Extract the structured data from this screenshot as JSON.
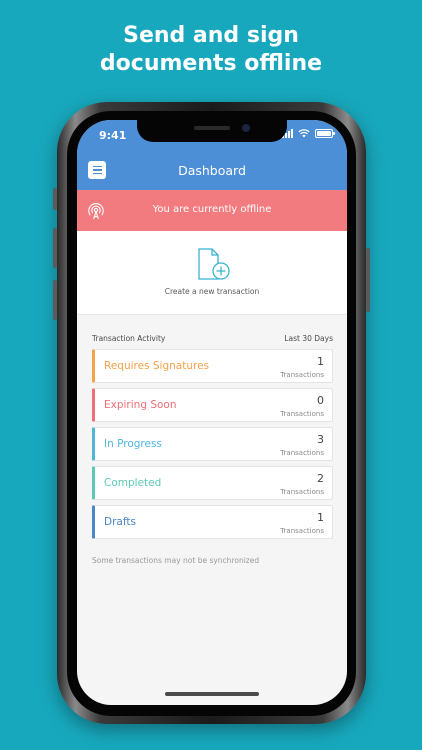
{
  "promo": {
    "headline_line1": "Send and sign",
    "headline_line2": "documents offline"
  },
  "status_bar": {
    "time": "9:41"
  },
  "header": {
    "title": "Dashboard",
    "menu_icon": "hamburger-menu-icon"
  },
  "offline_banner": {
    "text": "You are currently offline",
    "icon": "offline-broadcast-icon",
    "color": "#f27b7f"
  },
  "create": {
    "label": "Create a new transaction",
    "icon": "new-document-plus-icon"
  },
  "activity": {
    "title": "Transaction Activity",
    "range": "Last 30 Days",
    "rows": [
      {
        "label": "Requires Signatures",
        "count": "1",
        "unit": "Transactions",
        "color": "#f5a14a"
      },
      {
        "label": "Expiring Soon",
        "count": "0",
        "unit": "Transactions",
        "color": "#ee6f77"
      },
      {
        "label": "In Progress",
        "count": "3",
        "unit": "Transactions",
        "color": "#4fb6d8"
      },
      {
        "label": "Completed",
        "count": "2",
        "unit": "Transactions",
        "color": "#5cc9b7"
      },
      {
        "label": "Drafts",
        "count": "1",
        "unit": "Transactions",
        "color": "#4a86c8"
      }
    ],
    "footnote": "Some transactions may not be synchronized"
  },
  "colors": {
    "background": "#18a8bd",
    "header": "#4d8fd6",
    "accent_teal": "#38b2cf"
  }
}
